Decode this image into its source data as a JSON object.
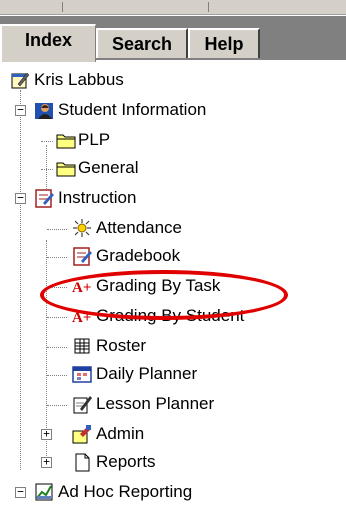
{
  "tabs": [
    {
      "label": "Index",
      "active": true
    },
    {
      "label": "Search",
      "active": false
    },
    {
      "label": "Help",
      "active": false
    }
  ],
  "tree": {
    "root": "Kris Labbus",
    "student_information": "Student Information",
    "plp": "PLP",
    "general": "General",
    "instruction": "Instruction",
    "attendance": "Attendance",
    "gradebook": "Gradebook",
    "grading_by_task": "Grading By Task",
    "grading_by_student": "Grading By Student",
    "roster": "Roster",
    "daily_planner": "Daily Planner",
    "lesson_planner": "Lesson Planner",
    "admin": "Admin",
    "reports": "Reports",
    "ad_hoc_reporting": "Ad Hoc Reporting"
  },
  "expanders": {
    "collapse": "−",
    "expand": "+"
  },
  "icons": {
    "grade_badge": "A+",
    "highlight_color": "#e00000"
  }
}
